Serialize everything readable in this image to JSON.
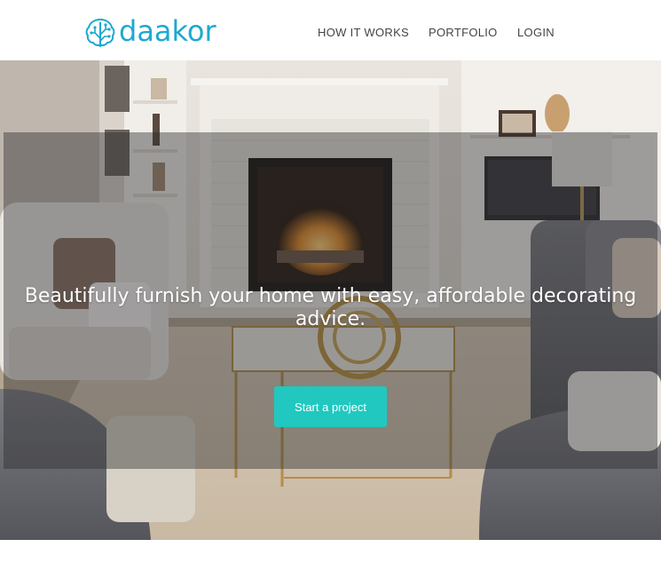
{
  "brand": {
    "name": "daakor",
    "color": "#1ca9d0"
  },
  "nav": {
    "items": [
      {
        "label": "HOW IT WORKS"
      },
      {
        "label": "PORTFOLIO"
      },
      {
        "label": "LOGIN"
      }
    ],
    "text_color": "#444444"
  },
  "hero": {
    "headline": "Beautifully furnish your home with easy, affordable decorating advice.",
    "cta_label": "Start a project",
    "cta_color": "#21c8bf",
    "background": "living-room-photo"
  }
}
